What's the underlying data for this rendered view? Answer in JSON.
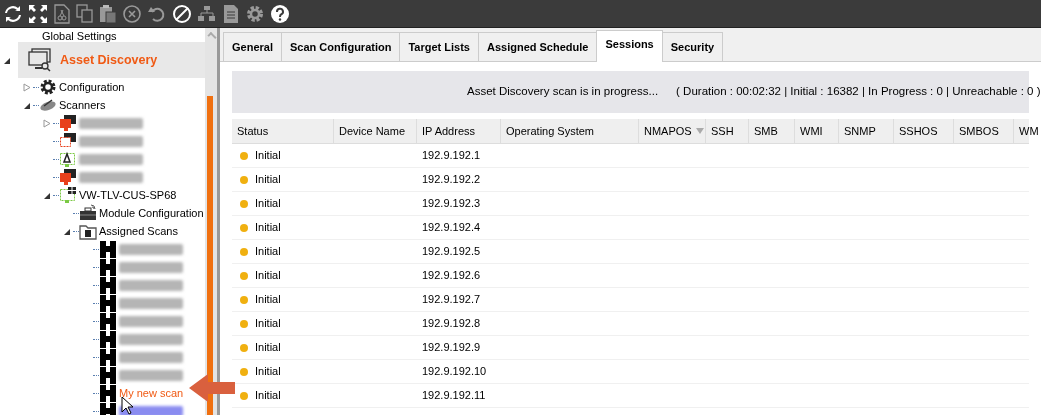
{
  "tree": {
    "top_item": {
      "label": "Global Settings"
    },
    "section": {
      "label": "Asset Discovery",
      "expanded": true
    },
    "items": [
      {
        "kind": "gear",
        "label": "Configuration",
        "expanded": false
      },
      {
        "kind": "radar",
        "label": "Scanners",
        "expanded": true,
        "children": [
          {
            "kind": "scanner-red",
            "expanded": false
          },
          {
            "kind": "scanner-outline"
          },
          {
            "kind": "scanner-linux"
          },
          {
            "kind": "scanner-red"
          },
          {
            "kind": "scanner-windows",
            "label": "VW-TLV-CUS-SP68",
            "expanded": true,
            "children": [
              {
                "kind": "module",
                "label": "Module Configuration"
              },
              {
                "kind": "folder",
                "label": "Assigned Scans",
                "expanded": true,
                "children": [
                  {
                    "kind": "scan",
                    "selected": false,
                    "highlighted": false
                  },
                  {
                    "kind": "scan",
                    "selected": false,
                    "highlighted": false
                  },
                  {
                    "kind": "scan",
                    "selected": false,
                    "highlighted": false
                  },
                  {
                    "kind": "scan",
                    "selected": false,
                    "highlighted": false
                  },
                  {
                    "kind": "scan",
                    "selected": false,
                    "highlighted": false
                  },
                  {
                    "kind": "scan",
                    "selected": false,
                    "highlighted": false
                  },
                  {
                    "kind": "scan",
                    "selected": false,
                    "highlighted": false
                  },
                  {
                    "kind": "scan",
                    "selected": false,
                    "highlighted": false
                  },
                  {
                    "kind": "scan",
                    "label": "My new scan",
                    "selected": false,
                    "highlighted": true
                  },
                  {
                    "kind": "scan",
                    "selected": true,
                    "highlighted": false
                  }
                ]
              }
            ]
          }
        ]
      }
    ]
  },
  "tabs": [
    {
      "label": "General",
      "selected": false
    },
    {
      "label": "Scan Configuration",
      "selected": false
    },
    {
      "label": "Target Lists",
      "selected": false
    },
    {
      "label": "Assigned Schedule",
      "selected": false
    },
    {
      "label": "Sessions",
      "selected": true
    },
    {
      "label": "Security",
      "selected": false
    }
  ],
  "progress": {
    "message": "Asset Discovery scan is in progress...",
    "details": "( Duration : 00:02:32 | Initial : 16382 | In Progress : 0 | Unreachable : 0 )"
  },
  "table": {
    "columns": [
      {
        "label": "Status"
      },
      {
        "label": "Device Name"
      },
      {
        "label": "IP Address"
      },
      {
        "label": "Operating System"
      },
      {
        "label": "NMAPOS",
        "sorted": true
      },
      {
        "label": "SSH"
      },
      {
        "label": "SMB"
      },
      {
        "label": "WMI"
      },
      {
        "label": "SNMP"
      },
      {
        "label": "SSHOS"
      },
      {
        "label": "SMBOS"
      },
      {
        "label": "WM"
      }
    ],
    "rows": [
      {
        "status": "Initial",
        "color": "#f0b010",
        "ip": "192.9.192.1"
      },
      {
        "status": "Initial",
        "color": "#f0b010",
        "ip": "192.9.192.2"
      },
      {
        "status": "Initial",
        "color": "#f0b010",
        "ip": "192.9.192.3"
      },
      {
        "status": "Initial",
        "color": "#f0b010",
        "ip": "192.9.192.4"
      },
      {
        "status": "Initial",
        "color": "#f0b010",
        "ip": "192.9.192.5"
      },
      {
        "status": "Initial",
        "color": "#f0b010",
        "ip": "192.9.192.6"
      },
      {
        "status": "Initial",
        "color": "#f0b010",
        "ip": "192.9.192.7"
      },
      {
        "status": "Initial",
        "color": "#f0b010",
        "ip": "192.9.192.8"
      },
      {
        "status": "Initial",
        "color": "#f0b010",
        "ip": "192.9.192.9"
      },
      {
        "status": "Initial",
        "color": "#f0b010",
        "ip": "192.9.192.10"
      },
      {
        "status": "Initial",
        "color": "#f0b010",
        "ip": "192.9.192.11"
      }
    ]
  }
}
